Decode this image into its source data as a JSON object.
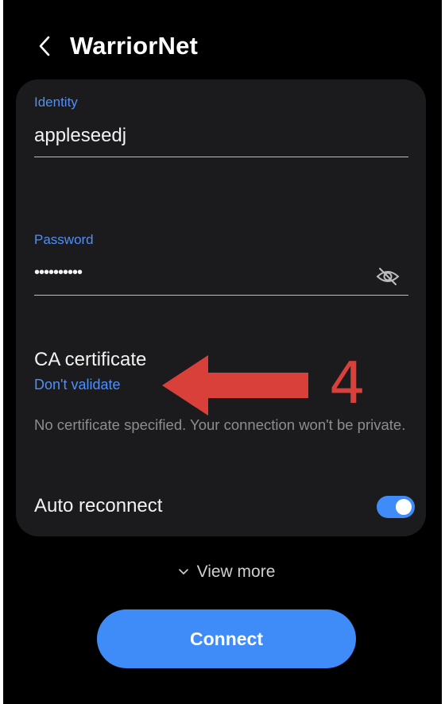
{
  "header": {
    "back_icon": "chevron-left-icon",
    "title": "WarriorNet"
  },
  "form": {
    "identity": {
      "label": "Identity",
      "value": "appleseedj"
    },
    "password": {
      "label": "Password",
      "value": "••••••••••",
      "visibility_icon": "eye-off-icon"
    },
    "ca_certificate": {
      "label": "CA certificate",
      "value": "Don't validate",
      "note": "No certificate specified. Your connection won't be private."
    },
    "auto_reconnect": {
      "label": "Auto reconnect",
      "enabled": true
    }
  },
  "annotation": {
    "number": "4",
    "arrow_icon": "left-arrow-annotation",
    "color": "#d9403a"
  },
  "footer": {
    "view_more_icon": "chevron-down-icon",
    "view_more_label": "View more",
    "connect_label": "Connect"
  },
  "colors": {
    "background": "#000000",
    "card": "#1b1b1d",
    "accent": "#3f8bf7",
    "label_blue": "#4f8ff7",
    "text": "#f2f2f2",
    "muted_text": "#8d8d8d"
  }
}
